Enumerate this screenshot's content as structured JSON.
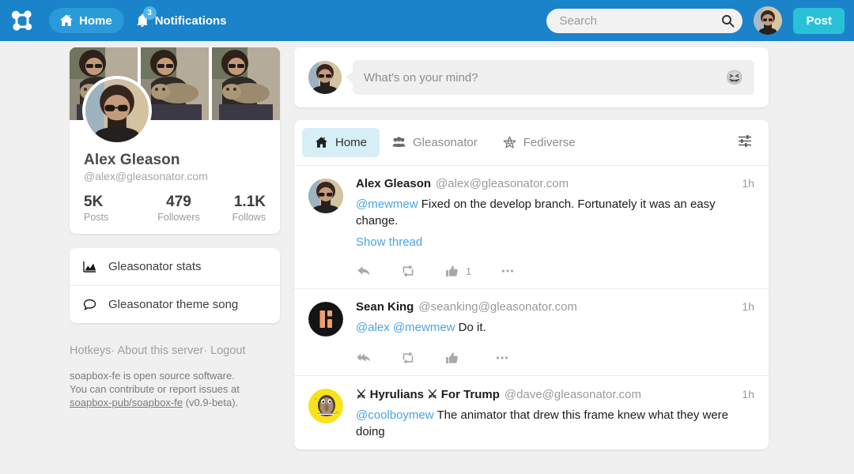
{
  "colors": {
    "nav_bg": "#1b83c9",
    "nav_pill": "#2b9ad8",
    "post_button": "#29c1d8",
    "badge": "#4fb4e8",
    "active_tab_bg": "#d8eef6",
    "link": "#4aa3e3",
    "page_bg": "#f0f0f1"
  },
  "topnav": {
    "logo_icon": "network-graph-logo",
    "home": {
      "label": "Home",
      "icon": "home-icon"
    },
    "notifications": {
      "label": "Notifications",
      "icon": "bell-icon",
      "badge": "3"
    },
    "search": {
      "placeholder": "Search",
      "value": "",
      "icon": "search-icon"
    },
    "avatar_icon": "user-avatar",
    "post_button": "Post"
  },
  "sidebar": {
    "profile": {
      "name": "Alex Gleason",
      "handle": "@alex@gleasonator.com",
      "banner_icon": "profile-banner-photo",
      "avatar_icon": "profile-avatar-photo",
      "stats": [
        {
          "value": "5K",
          "label": "Posts"
        },
        {
          "value": "479",
          "label": "Followers"
        },
        {
          "value": "1.1K",
          "label": "Follows"
        }
      ]
    },
    "menu": [
      {
        "label": "Gleasonator stats",
        "icon": "chart-icon"
      },
      {
        "label": "Gleasonator theme song",
        "icon": "chat-bubble-icon"
      }
    ],
    "footer": {
      "links": [
        "Hotkeys",
        "About this server",
        "Logout"
      ],
      "separator": "·",
      "note_before": "soapbox-fe is open source software. You can contribute or report issues at ",
      "note_link": "soapbox-pub/soapbox-fe",
      "note_after": " (v0.9-beta)."
    }
  },
  "compose": {
    "avatar_icon": "compose-avatar-photo",
    "placeholder": "What's on your mind?",
    "value": "",
    "emoji_icon": "grinning-squinting-face"
  },
  "timeline": {
    "tabs": [
      {
        "label": "Home",
        "icon": "home-icon",
        "active": true
      },
      {
        "label": "Gleasonator",
        "icon": "people-group-icon",
        "active": false
      },
      {
        "label": "Fediverse",
        "icon": "fediverse-star-icon",
        "active": false
      }
    ],
    "filter_icon": "sliders-filter-icon",
    "posts": [
      {
        "avatar_icon": "avatar-alex",
        "name": "Alex Gleason",
        "handle": "@alex@gleasonator.com",
        "time": "1h",
        "mentions": [
          "@mewmew"
        ],
        "text": " Fixed on the develop branch. Fortunately it was an easy change.",
        "show_thread": "Show thread",
        "actions": {
          "reply_icon": "reply-icon",
          "repost_icon": "repost-icon",
          "like_icon": "thumbs-up-icon",
          "like_count": "1",
          "more_icon": "ellipsis-icon"
        }
      },
      {
        "avatar_icon": "avatar-sean-king",
        "name": "Sean King",
        "handle": "@seanking@gleasonator.com",
        "time": "1h",
        "mentions": [
          "@alex",
          "@mewmew"
        ],
        "text": " Do it.",
        "show_thread": "",
        "actions": {
          "reply_icon": "reply-all-icon",
          "repost_icon": "repost-icon",
          "like_icon": "thumbs-up-icon",
          "like_count": "",
          "more_icon": "ellipsis-icon"
        }
      },
      {
        "avatar_icon": "avatar-hyrulians",
        "name": "⚔ Hyrulians ⚔ For Trump",
        "handle": "@dave@gleasonator.com",
        "time": "1h",
        "mentions": [
          "@coolboymew"
        ],
        "text": " The animator that drew this frame knew what they were doing",
        "show_thread": "",
        "actions": null
      }
    ]
  }
}
